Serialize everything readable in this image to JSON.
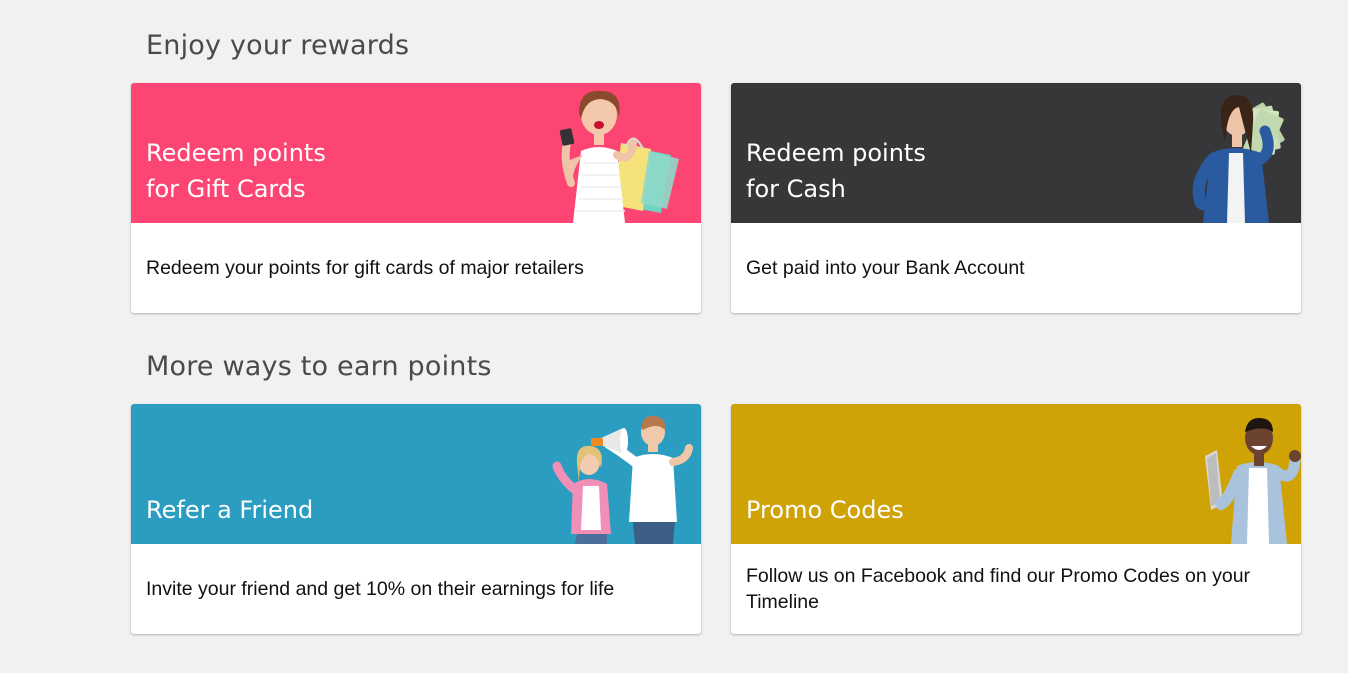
{
  "sections": {
    "rewards_title": "Enjoy your rewards",
    "earn_title": "More ways to earn points"
  },
  "cards": {
    "gift": {
      "title": "Redeem points\nfor Gift Cards",
      "description": "Redeem your points for gift cards of major retailers",
      "color": "#fc4573",
      "image": "woman-shopping-bags-illustration"
    },
    "cash": {
      "title": "Redeem points\nfor Cash",
      "description": "Get paid into your Bank Account",
      "color": "#373739",
      "image": "woman-holding-cash-illustration"
    },
    "refer": {
      "title": "Refer a Friend",
      "description": "Invite your friend and get 10% on their earnings for life",
      "color": "#2a9dc1",
      "image": "friends-megaphone-illustration"
    },
    "promo": {
      "title": "Promo Codes",
      "description": "Follow us on Facebook and find our Promo Codes on your Timeline",
      "color": "#cfa306",
      "image": "man-with-laptop-illustration"
    }
  },
  "colors": {
    "page_background": "#f1f1f1",
    "card_background": "#ffffff",
    "heading_text": "#4a4a4a",
    "body_text": "#111111"
  }
}
